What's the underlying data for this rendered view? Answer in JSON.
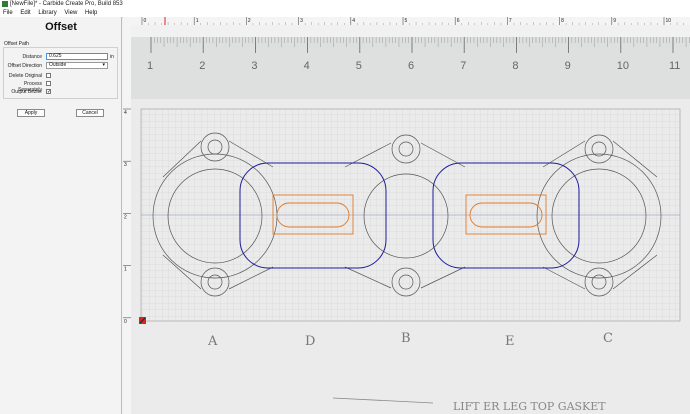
{
  "window": {
    "title": "[NewFile]* - Carbide Create Pro, Build 853"
  },
  "menu": {
    "items": [
      "File",
      "Edit",
      "Library",
      "View",
      "Help"
    ]
  },
  "panel": {
    "title": "Offset",
    "group_label": "Offset Path",
    "distance_label": "Distance",
    "distance_value": "0.625",
    "distance_unit": "in",
    "direction_label": "Offset Direction",
    "direction_value": "Outside",
    "delete_original_label": "Delete Original",
    "delete_original_checked": false,
    "process_separately_label": "Process Separately",
    "process_separately_checked": false,
    "output_bezier_label": "Output Bezier",
    "output_bezier_checked": true,
    "apply_label": "Apply",
    "cancel_label": "Cancel"
  },
  "canvas": {
    "ruler_numbers": [
      "0",
      "1",
      "2",
      "3",
      "4",
      "5",
      "6",
      "7",
      "8",
      "9",
      "10"
    ],
    "photo_ruler_numbers": [
      "1",
      "2",
      "3",
      "4",
      "5",
      "6",
      "7",
      "8",
      "9",
      "10",
      "11"
    ],
    "left_ruler_numbers": [
      "4",
      "3",
      "2",
      "1",
      "0"
    ],
    "handwritten_labels": [
      "A",
      "D",
      "B",
      "E",
      "C"
    ],
    "handwritten_caption": "LIFT ER LEG TOP GASKET",
    "colors": {
      "selection": "#1c1c9c",
      "original": "#e07a2a",
      "guide": "#808080"
    }
  }
}
